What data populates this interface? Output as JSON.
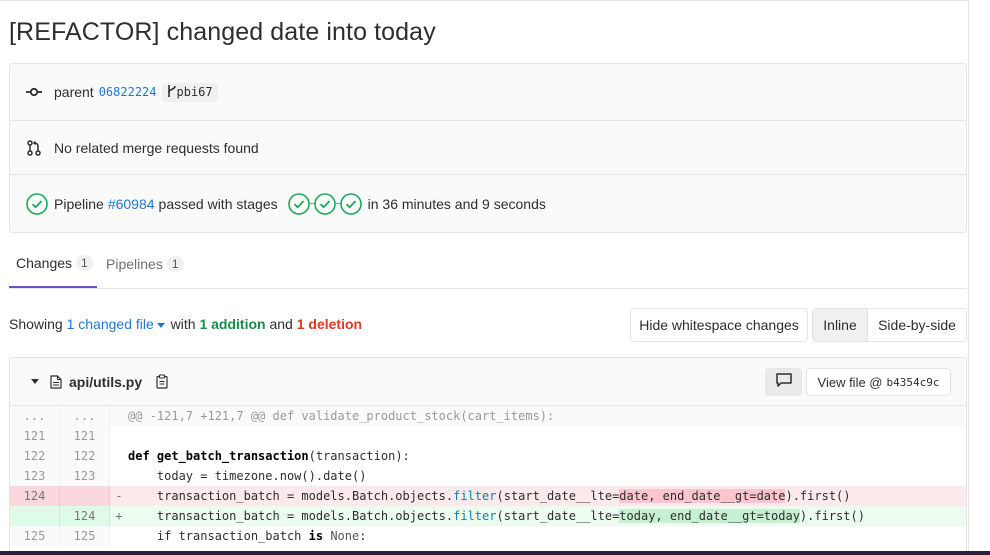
{
  "commit": {
    "title": "[REFACTOR] changed date into today",
    "parent_label": "parent",
    "parent_sha": "06822224",
    "branch": "pbi67",
    "merge_requests_text": "No related merge requests found",
    "pipeline": {
      "prefix": "Pipeline",
      "id_link": "#60984",
      "passed_text": "passed with stages",
      "duration_text": "in 36 minutes and 9 seconds"
    }
  },
  "tabs": [
    {
      "label": "Changes",
      "count": "1"
    },
    {
      "label": "Pipelines",
      "count": "1"
    }
  ],
  "summary": {
    "showing": "Showing",
    "changed_files": "1 changed file",
    "with": "with",
    "additions": "1 addition",
    "and": "and",
    "deletions": "1 deletion"
  },
  "toolbar": {
    "hide_whitespace": "Hide whitespace changes",
    "inline": "Inline",
    "side_by_side": "Side-by-side"
  },
  "file": {
    "path": "api/utils.py",
    "view_file_label": "View file @",
    "view_file_sha": "b4354c9c"
  },
  "diff": {
    "hunk_marker_old": "...",
    "hunk_marker_new": "...",
    "hunk_header": "@@ -121,7 +121,7 @@ def validate_product_stock(cart_items):",
    "lines": [
      {
        "old": "121",
        "new": "121",
        "sign": "",
        "text": ""
      },
      {
        "old": "122",
        "new": "122",
        "sign": "",
        "pre": "def ",
        "fn": "get_batch_transaction",
        "post": "(transaction):"
      },
      {
        "old": "123",
        "new": "123",
        "sign": "",
        "text": "    today = timezone.now().date()"
      },
      {
        "old": "124",
        "new": "",
        "sign": "-",
        "a": "    transaction_batch = models.Batch.objects.",
        "b": "filter",
        "c": "(start_date__lte=",
        "hl": "date, end_date__gt=date",
        "d": ").first()"
      },
      {
        "old": "",
        "new": "124",
        "sign": "+",
        "a": "    transaction_batch = models.Batch.objects.",
        "b": "filter",
        "c": "(start_date__lte=",
        "hl": "today, end_date__gt=today",
        "d": ").first()"
      },
      {
        "old": "125",
        "new": "125",
        "sign": "",
        "pre": "    if transaction_batch ",
        "kw": "is",
        "mid": " ",
        "none": "None",
        "post": ":"
      }
    ]
  }
}
